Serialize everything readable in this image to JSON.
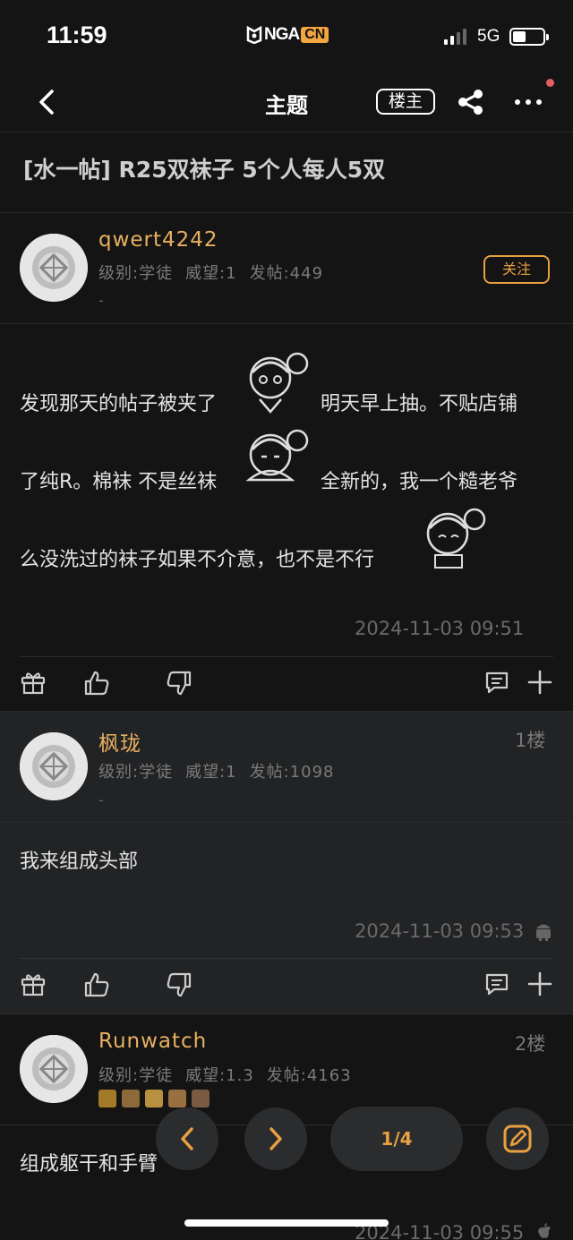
{
  "status_bar": {
    "time": "11:59",
    "network": "5G",
    "logo_text": "NGA",
    "logo_suffix": "CN"
  },
  "nav": {
    "title": "主题",
    "op_filter_label": "楼主"
  },
  "thread": {
    "title": "[水一帖] R25双袜子 5个人每人5双"
  },
  "posts": [
    {
      "username": "qwert4242",
      "level": "级别:学徒",
      "prestige": "威望:1",
      "post_count": "发帖:449",
      "signature": "-",
      "follow_label": "关注",
      "content_lines": [
        "发现那天的帖子被夹了",
        "明天早上抽。不贴店铺",
        "了纯R。棉袜 不是丝袜",
        "全新的，我一个糙老爷",
        "么没洗过的袜子如果不介意，也不是不行"
      ],
      "timestamp": "2024-11-03 09:51"
    },
    {
      "username": "枫珑",
      "floor": "1楼",
      "level": "级别:学徒",
      "prestige": "威望:1",
      "post_count": "发帖:1098",
      "signature": "-",
      "content": "我来组成头部",
      "timestamp": "2024-11-03 09:53",
      "device_icon": "android-icon"
    },
    {
      "username": "Runwatch",
      "floor": "2楼",
      "level": "级别:学徒",
      "prestige": "威望:1.3",
      "post_count": "发帖:4163",
      "content": "组成躯干和手臂",
      "timestamp": "2024-11-03 09:55",
      "device_icon": "apple-icon"
    }
  ],
  "pagination": {
    "label": "1/4"
  },
  "colors": {
    "accent": "#e8a040",
    "username": "#e8b060",
    "background": "#141414",
    "floor_background": "#222325"
  }
}
